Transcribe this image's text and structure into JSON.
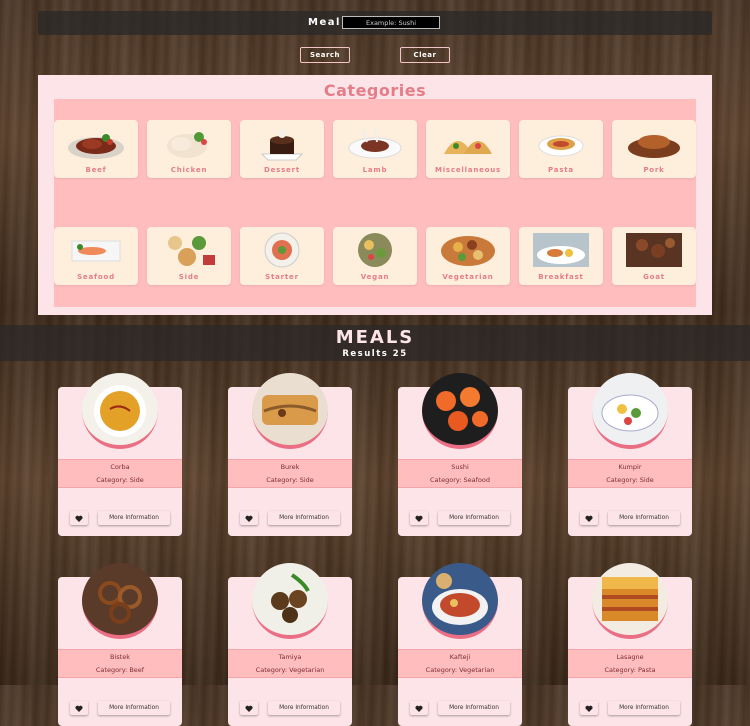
{
  "search": {
    "label": "Meal",
    "placeholder": "Example: Sushi",
    "search_label": "Search",
    "clear_label": "Clear"
  },
  "categories": {
    "title": "Categories",
    "items": [
      {
        "name": "Beef"
      },
      {
        "name": "Chicken"
      },
      {
        "name": "Dessert"
      },
      {
        "name": "Lamb"
      },
      {
        "name": "Miscellaneous"
      },
      {
        "name": "Pasta"
      },
      {
        "name": "Pork"
      },
      {
        "name": "Seafood"
      },
      {
        "name": "Side"
      },
      {
        "name": "Starter"
      },
      {
        "name": "Vegan"
      },
      {
        "name": "Vegetarian"
      },
      {
        "name": "Breakfast"
      },
      {
        "name": "Goat"
      }
    ]
  },
  "meals": {
    "title": "MEALS",
    "results_label": "Results 25",
    "more_info_label": "More Information",
    "items": [
      {
        "name": "Corba",
        "category": "Category: Side"
      },
      {
        "name": "Burek",
        "category": "Category: Side"
      },
      {
        "name": "Sushi",
        "category": "Category: Seafood"
      },
      {
        "name": "Kumpir",
        "category": "Category: Side"
      },
      {
        "name": "Bistek",
        "category": "Category: Beef"
      },
      {
        "name": "Tamiya",
        "category": "Category: Vegetarian"
      },
      {
        "name": "Kafteji",
        "category": "Category: Vegetarian"
      },
      {
        "name": "Lasagne",
        "category": "Category: Pasta"
      }
    ]
  },
  "colors": {
    "accent": "#e47d88",
    "panel": "#fde4e8",
    "inner": "#ffbdbe",
    "card": "#feeedc"
  }
}
